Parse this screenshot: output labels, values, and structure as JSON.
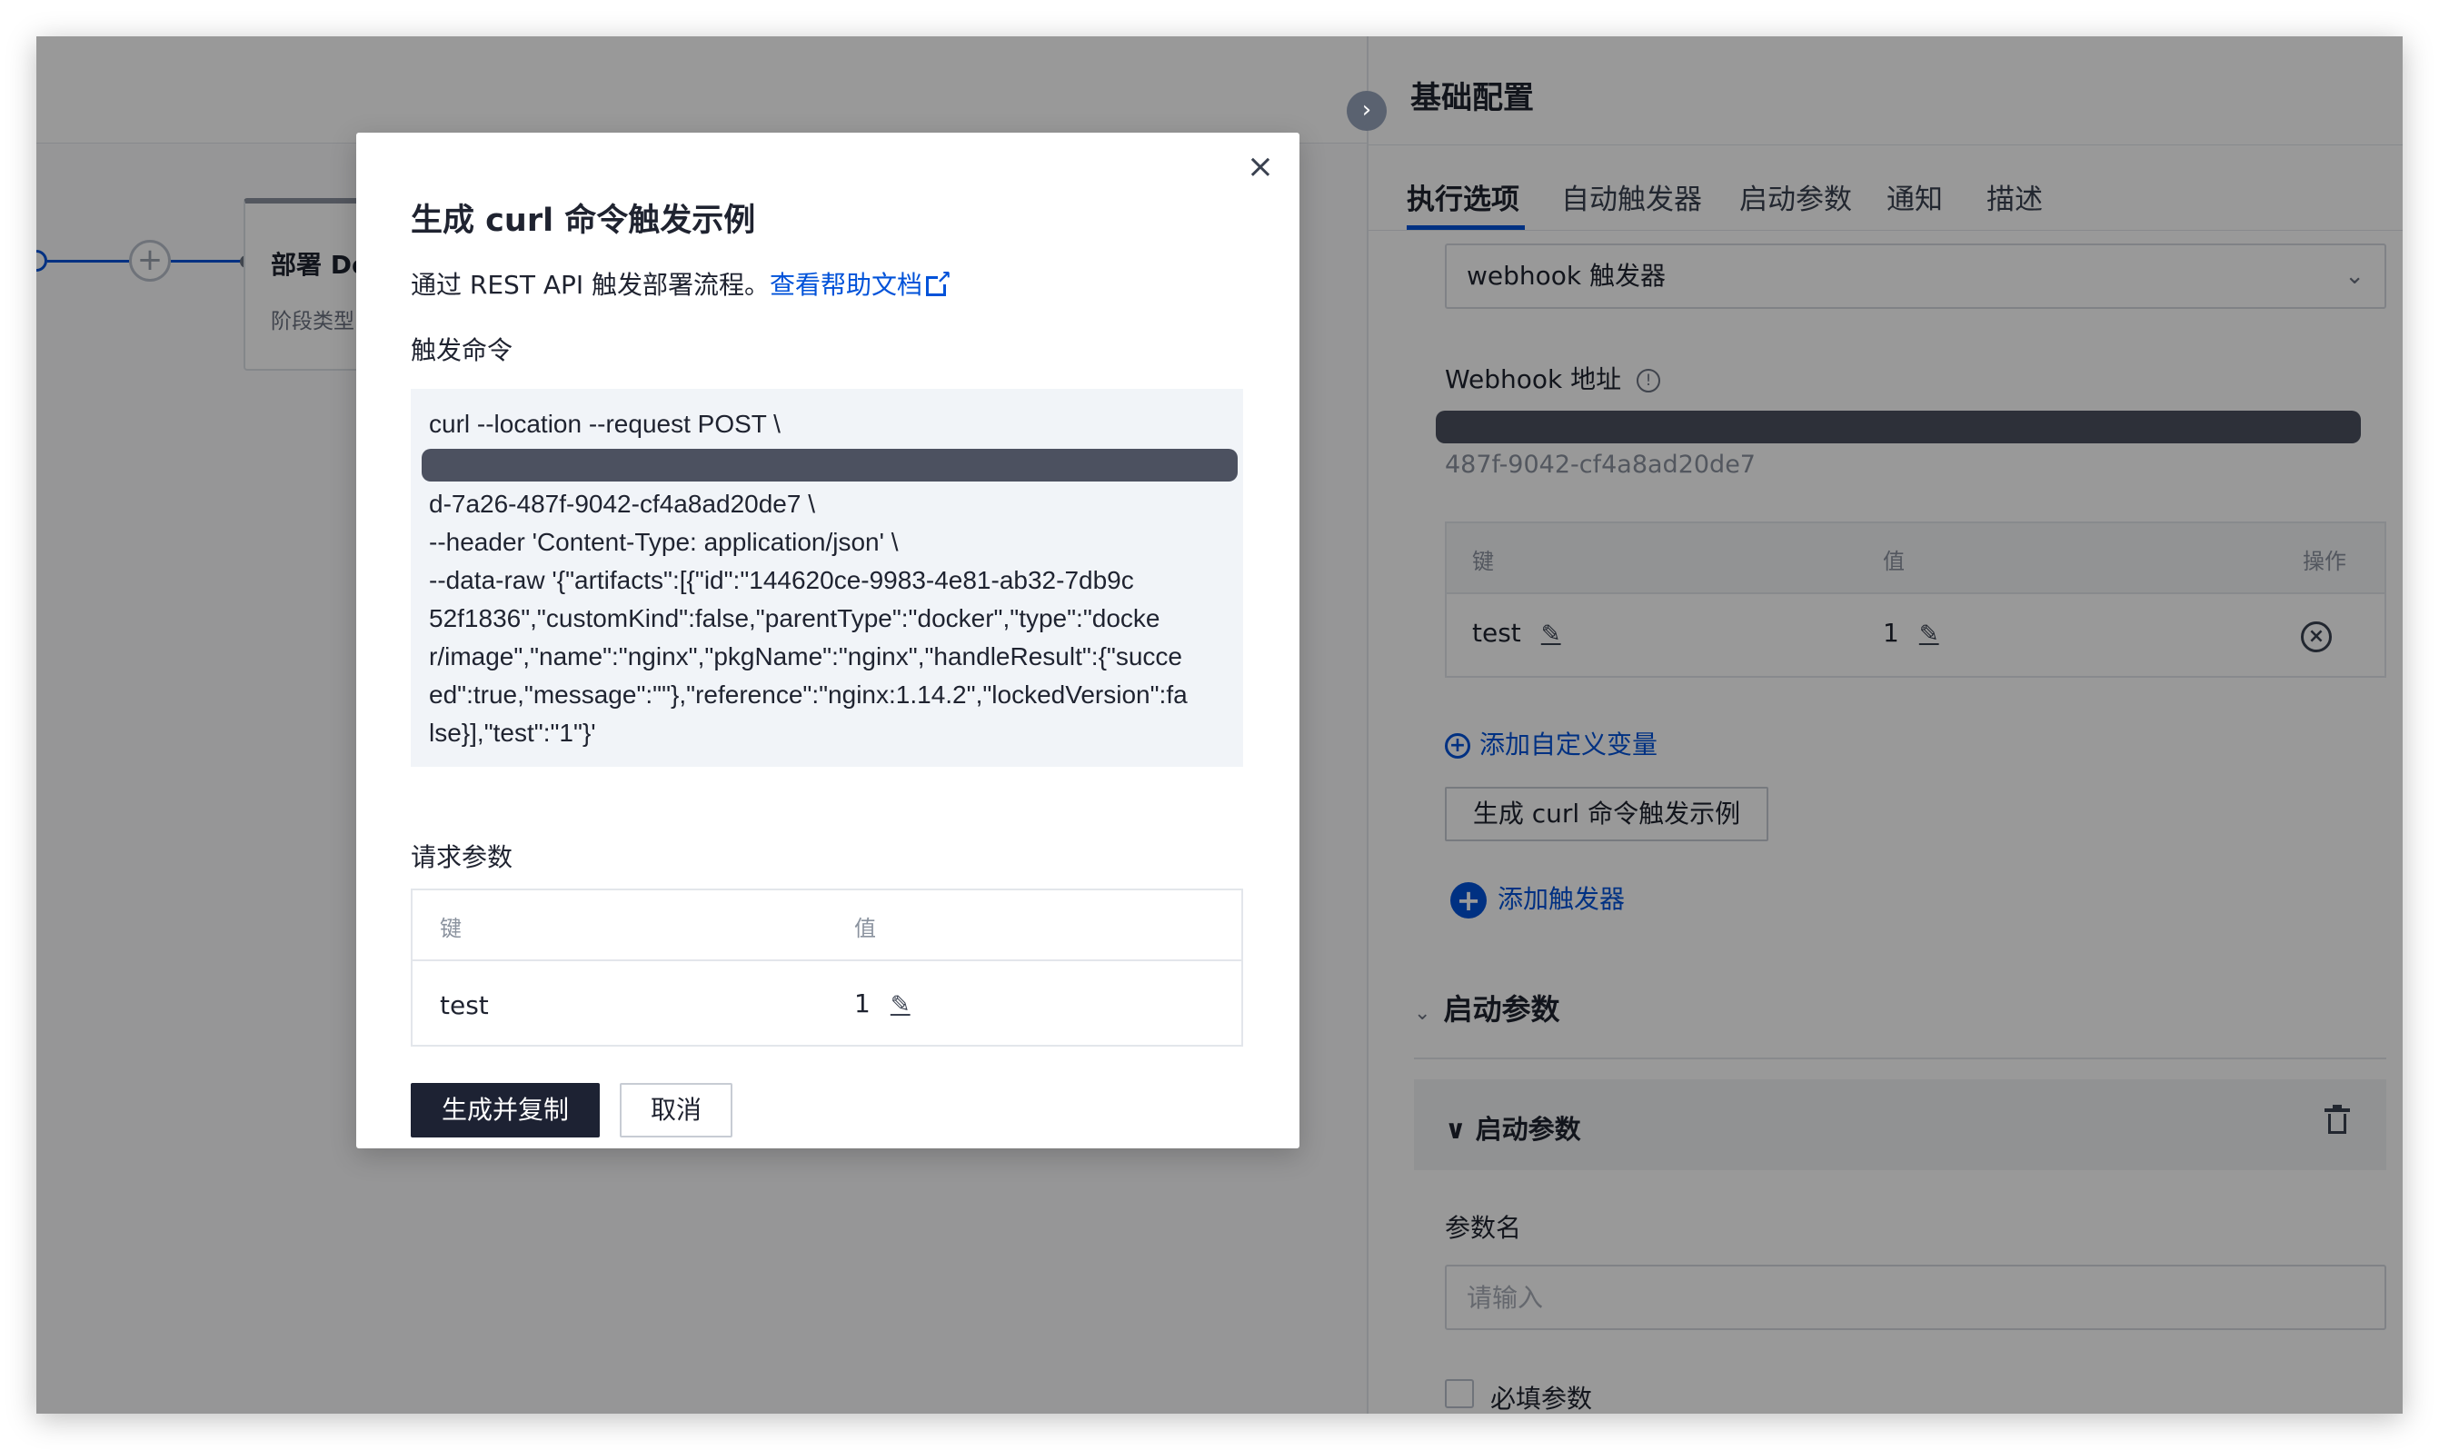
{
  "canvas": {
    "stage_title": "部署 De",
    "stage_subtitle": "阶段类型",
    "add_symbol": "+"
  },
  "drawer": {
    "title": "基础配置",
    "collapse_symbol": "›",
    "tabs": [
      {
        "label": "执行选项",
        "active": true
      },
      {
        "label": "自动触发器",
        "active": false
      },
      {
        "label": "启动参数",
        "active": false
      },
      {
        "label": "通知",
        "active": false
      },
      {
        "label": "描述",
        "active": false
      }
    ],
    "trigger_select": {
      "value": "webhook 触发器",
      "chevron": "⌄"
    },
    "webhook_label": "Webhook 地址",
    "webhook_info": "!",
    "webhook_tail": "487f-9042-cf4a8ad20de7",
    "variables_table": {
      "columns": [
        "键",
        "值",
        "操作"
      ],
      "rows": [
        {
          "key": "test",
          "value": "1"
        }
      ]
    },
    "edit_icon": "✎",
    "remove_icon": "×",
    "add_variable": "添加自定义变量",
    "generate_curl": "生成 curl 命令触发示例",
    "add_trigger": "添加触发器",
    "plus": "+",
    "startup_section": "启动参数",
    "section_caret": "⌄",
    "param_panel": {
      "title": "启动参数",
      "caret": "∨"
    },
    "param_name_label": "参数名",
    "param_name_placeholder": "请输入",
    "required_label": "必填参数"
  },
  "modal": {
    "close": "×",
    "title": "生成 curl 命令触发示例",
    "desc_prefix": "通过 REST API 触发部署流程。",
    "help_link": "查看帮助文档",
    "command_label": "触发命令",
    "command_lines": [
      "curl --location --request POST \\",
      "d-7a26-487f-9042-cf4a8ad20de7 \\",
      "--header 'Content-Type: application/json' \\",
      "--data-raw '{\"artifacts\":[{\"id\":\"144620ce-9983-4e81-ab32-7db9c",
      "52f1836\",\"customKind\":false,\"parentType\":\"docker\",\"type\":\"docke",
      "r/image\",\"name\":\"nginx\",\"pkgName\":\"nginx\",\"handleResult\":{\"succe",
      "ed\":true,\"message\":\"\"},\"reference\":\"nginx:1.14.2\",\"lockedVersion\":fa",
      "lse}],\"test\":\"1\"}'"
    ],
    "params_label": "请求参数",
    "params_table": {
      "columns": [
        "键",
        "值"
      ],
      "rows": [
        {
          "key": "test",
          "value": "1"
        }
      ]
    },
    "edit_icon": "✎",
    "primary_button": "生成并复制",
    "cancel_button": "取消"
  },
  "colors": {
    "accent": "#0052d9",
    "primary_button": "#1d2233",
    "overlay": "rgba(0,0,0,0.40)"
  }
}
